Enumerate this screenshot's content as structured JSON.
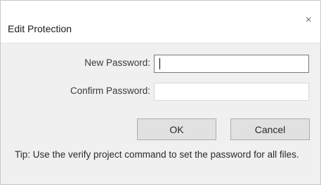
{
  "dialog": {
    "title": "Edit Protection",
    "close_glyph": "×",
    "close_icon": "close-icon"
  },
  "form": {
    "new_password_label": "New Password:",
    "new_password_value": "",
    "confirm_password_label": "Confirm Password:",
    "confirm_password_value": ""
  },
  "buttons": {
    "ok_label": "OK",
    "cancel_label": "Cancel"
  },
  "tip": {
    "text": "Tip: Use the verify project command to set the password for all files."
  }
}
